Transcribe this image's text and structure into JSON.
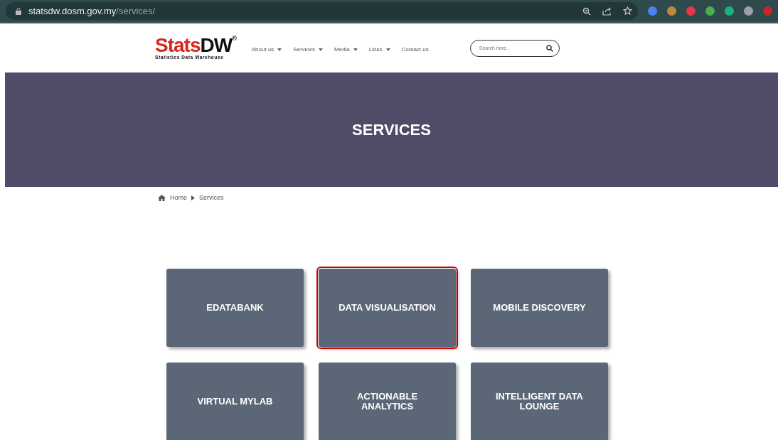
{
  "browser": {
    "url_host": "statsdw.dosm.gov.my",
    "url_path": "/services/"
  },
  "header": {
    "logo_main": "Stats",
    "logo_accent": "DW",
    "logo_mark": "®",
    "logo_subtitle": "Statistics Data Warehouse",
    "nav": [
      {
        "label": "About us",
        "dropdown": true
      },
      {
        "label": "Services",
        "dropdown": true
      },
      {
        "label": "Media",
        "dropdown": true
      },
      {
        "label": "Links",
        "dropdown": true
      },
      {
        "label": "Contact us",
        "dropdown": false
      }
    ],
    "search": {
      "placeholder": "Search here.."
    }
  },
  "banner": {
    "title": "SERVICES"
  },
  "breadcrumb": [
    {
      "label": "Home"
    },
    {
      "label": "Services"
    }
  ],
  "services": [
    {
      "label": "EDATABANK",
      "selected": false
    },
    {
      "label": "DATA VISUALISATION",
      "selected": true
    },
    {
      "label": "MOBILE DISCOVERY",
      "selected": false
    },
    {
      "label": "VIRTUAL MYLAB",
      "selected": false
    },
    {
      "label": "ACTIONABLE ANALYTICS",
      "selected": false
    },
    {
      "label": "INTELLIGENT DATA LOUNGE",
      "selected": false
    }
  ]
}
